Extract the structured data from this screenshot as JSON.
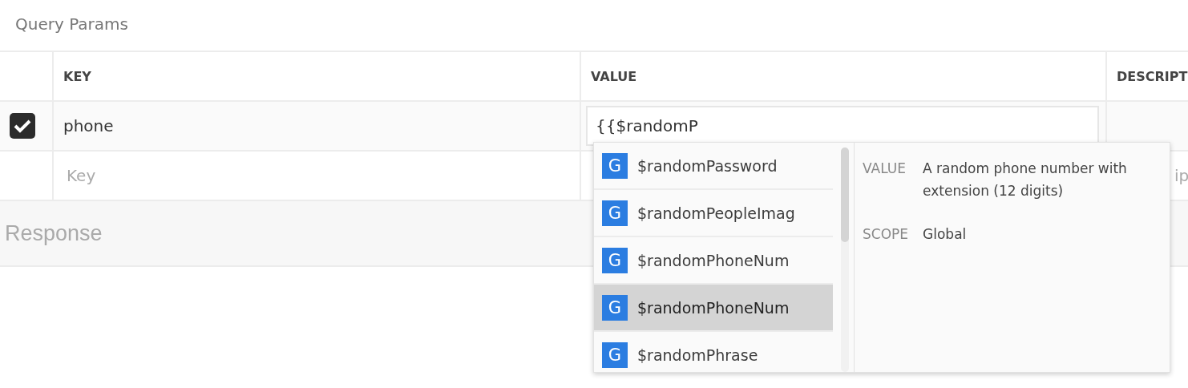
{
  "section_title": "Query Params",
  "columns": [
    "KEY",
    "VALUE",
    "DESCRIPT"
  ],
  "params": [
    {
      "enabled": true,
      "key": "phone",
      "value": "{{$randomP"
    }
  ],
  "new_row": {
    "key_placeholder": "Key",
    "description_placeholder": "ip"
  },
  "response_title": "Response",
  "autocomplete": {
    "items": [
      {
        "badge": "G",
        "name": "$randomPassword",
        "selected": false
      },
      {
        "badge": "G",
        "name": "$randomPeopleImag",
        "selected": false
      },
      {
        "badge": "G",
        "name": "$randomPhoneNum",
        "selected": false
      },
      {
        "badge": "G",
        "name": "$randomPhoneNum",
        "selected": true
      },
      {
        "badge": "G",
        "name": "$randomPhrase",
        "selected": false
      }
    ],
    "detail": {
      "value_label": "VALUE",
      "value": "A random phone number with extension (12 digits)",
      "scope_label": "SCOPE",
      "scope": "Global"
    }
  }
}
